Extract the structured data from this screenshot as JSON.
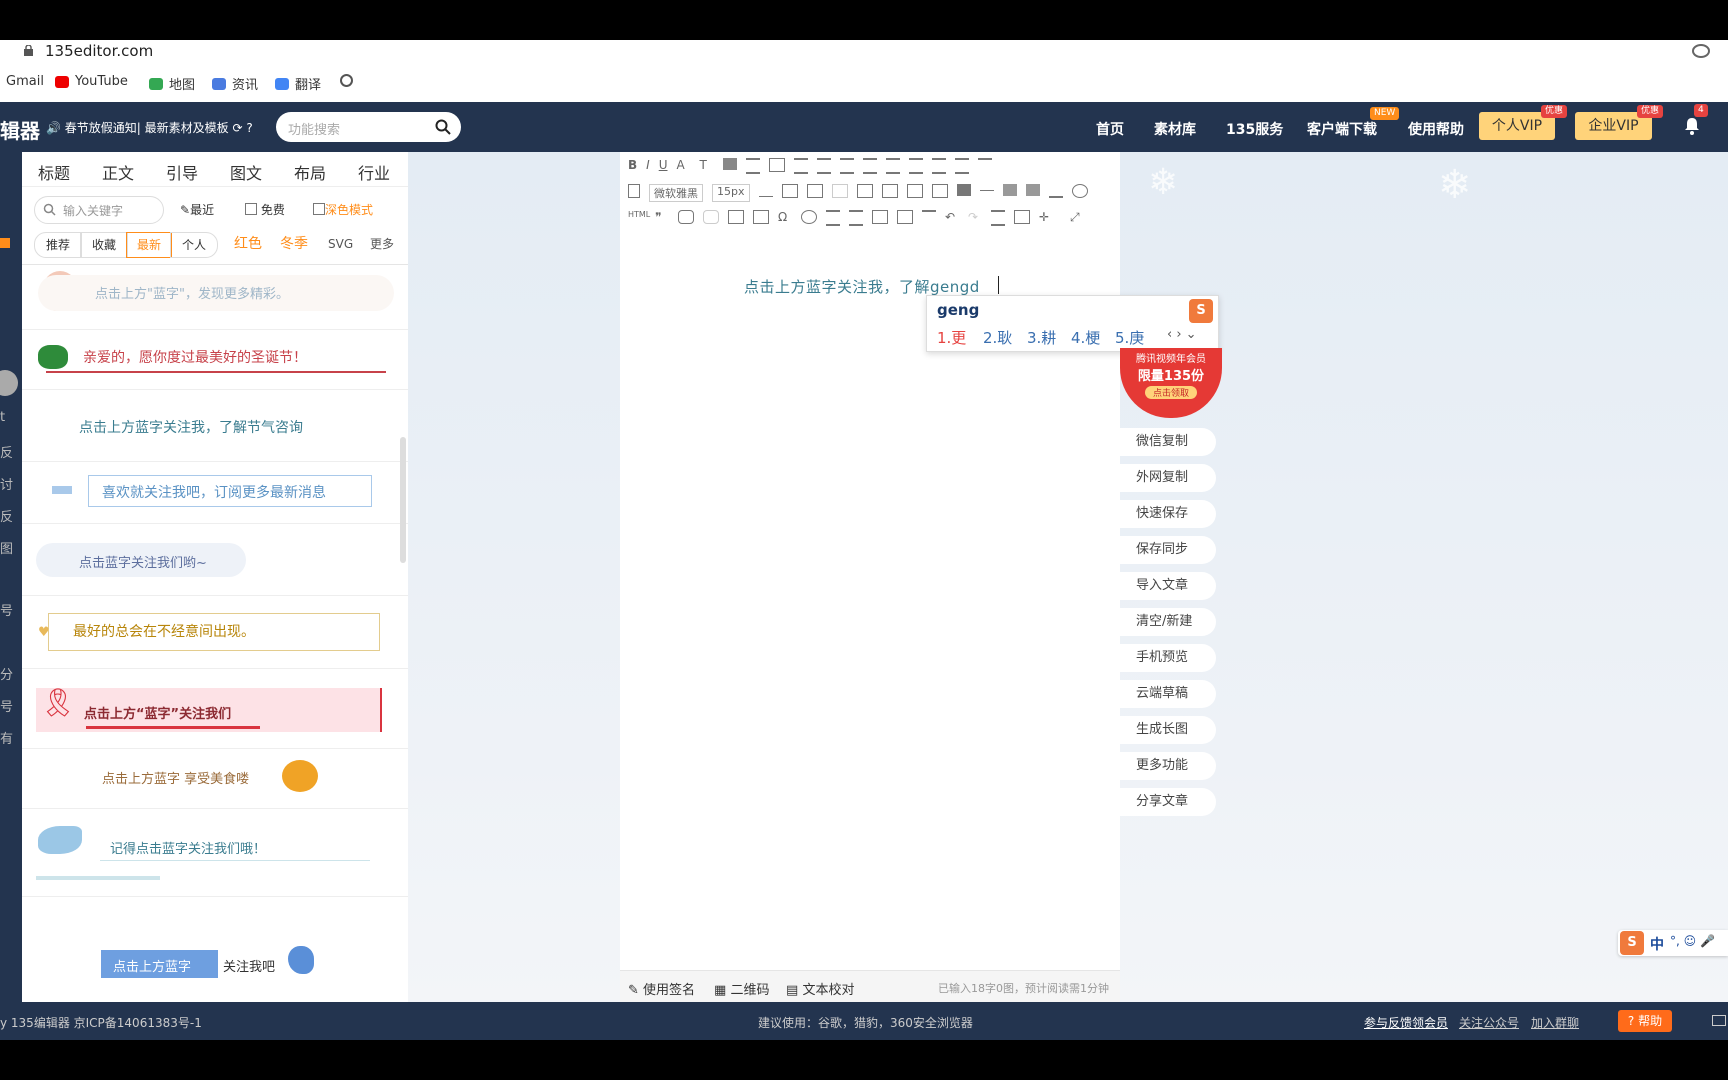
{
  "browser": {
    "url": "135editor.com",
    "bookmarks": [
      "Gmail",
      "YouTube",
      "地图",
      "资讯",
      "翻译"
    ]
  },
  "header": {
    "logo": "辑器",
    "notice": "春节放假通知| 最新素材及模板",
    "search_placeholder": "功能搜索",
    "nav": [
      "首页",
      "素材库",
      "135服务",
      "客户端下载",
      "使用帮助"
    ],
    "new_badge": "NEW",
    "vip_personal": "个人VIP",
    "vip_enterprise": "企业VIP",
    "vip_badge": "优惠",
    "notification_count": "4"
  },
  "strip": {
    "items": [
      "t",
      "反",
      "讨",
      "反",
      "图",
      "号",
      "分",
      "号",
      "有"
    ]
  },
  "sidebar": {
    "tabs": [
      "标题",
      "正文",
      "引导",
      "图文",
      "布局",
      "行业"
    ],
    "keyword_placeholder": "输入关键字",
    "recent": "最近",
    "free": "免费",
    "dark_mode": "深色模式",
    "filters": [
      "推荐",
      "收藏",
      "最新",
      "个人"
    ],
    "tags": [
      "红色",
      "冬季",
      "SVG",
      "更多"
    ],
    "cards": [
      "点击上方\"蓝字\"，发现更多精彩。",
      "亲爱的，愿你度过最美好的圣诞节！",
      "点击上方蓝字关注我，了解节气咨询",
      "喜欢就关注我吧，订阅更多最新消息",
      "点击蓝字关注我们哟~",
      "最好的总会在不经意间出现。",
      "点击上方“蓝字”关注我们",
      "点击上方蓝字 享受美食喽",
      "记得点击蓝字关注我们哦！",
      "点击上方蓝字",
      "关注我吧"
    ]
  },
  "editor": {
    "font_name": "微软雅黑",
    "font_size": "15px",
    "content_text": "点击上方蓝字关注我，了解gengd",
    "ime_input": "geng",
    "ime_candidates": [
      "1.更",
      "2.耿",
      "3.耕",
      "4.梗",
      "5.庚"
    ],
    "footer_sign": "使用签名",
    "footer_qr": "二维码",
    "footer_proof": "文本校对",
    "footer_stats": "已输入18字0图，预计阅读需1分钟"
  },
  "promo": {
    "line1": "腾讯视频年会员",
    "line2": "限量135份",
    "btn": "点击领取"
  },
  "actions": [
    "微信复制",
    "外网复制",
    "快速保存",
    "保存同步",
    "导入文章",
    "清空/新建",
    "手机预览",
    "云端草稿",
    "生成长图",
    "更多功能",
    "分享文章"
  ],
  "footer": {
    "copyright": "y 135编辑器  京ICP备14061383号-1",
    "suggest": "建议使用：谷歌，猎豹，360安全浏览器",
    "links": [
      "参与反馈领会员",
      "关注公众号",
      "加入群聊"
    ],
    "help": "帮助"
  },
  "ime_bar": {
    "label": "中"
  },
  "colors": {
    "header_bg": "#23344f",
    "accent": "#ff8d1a",
    "vip_bg": "#ffd37a",
    "red": "#e64340",
    "link_blue": "#4a90e2"
  }
}
